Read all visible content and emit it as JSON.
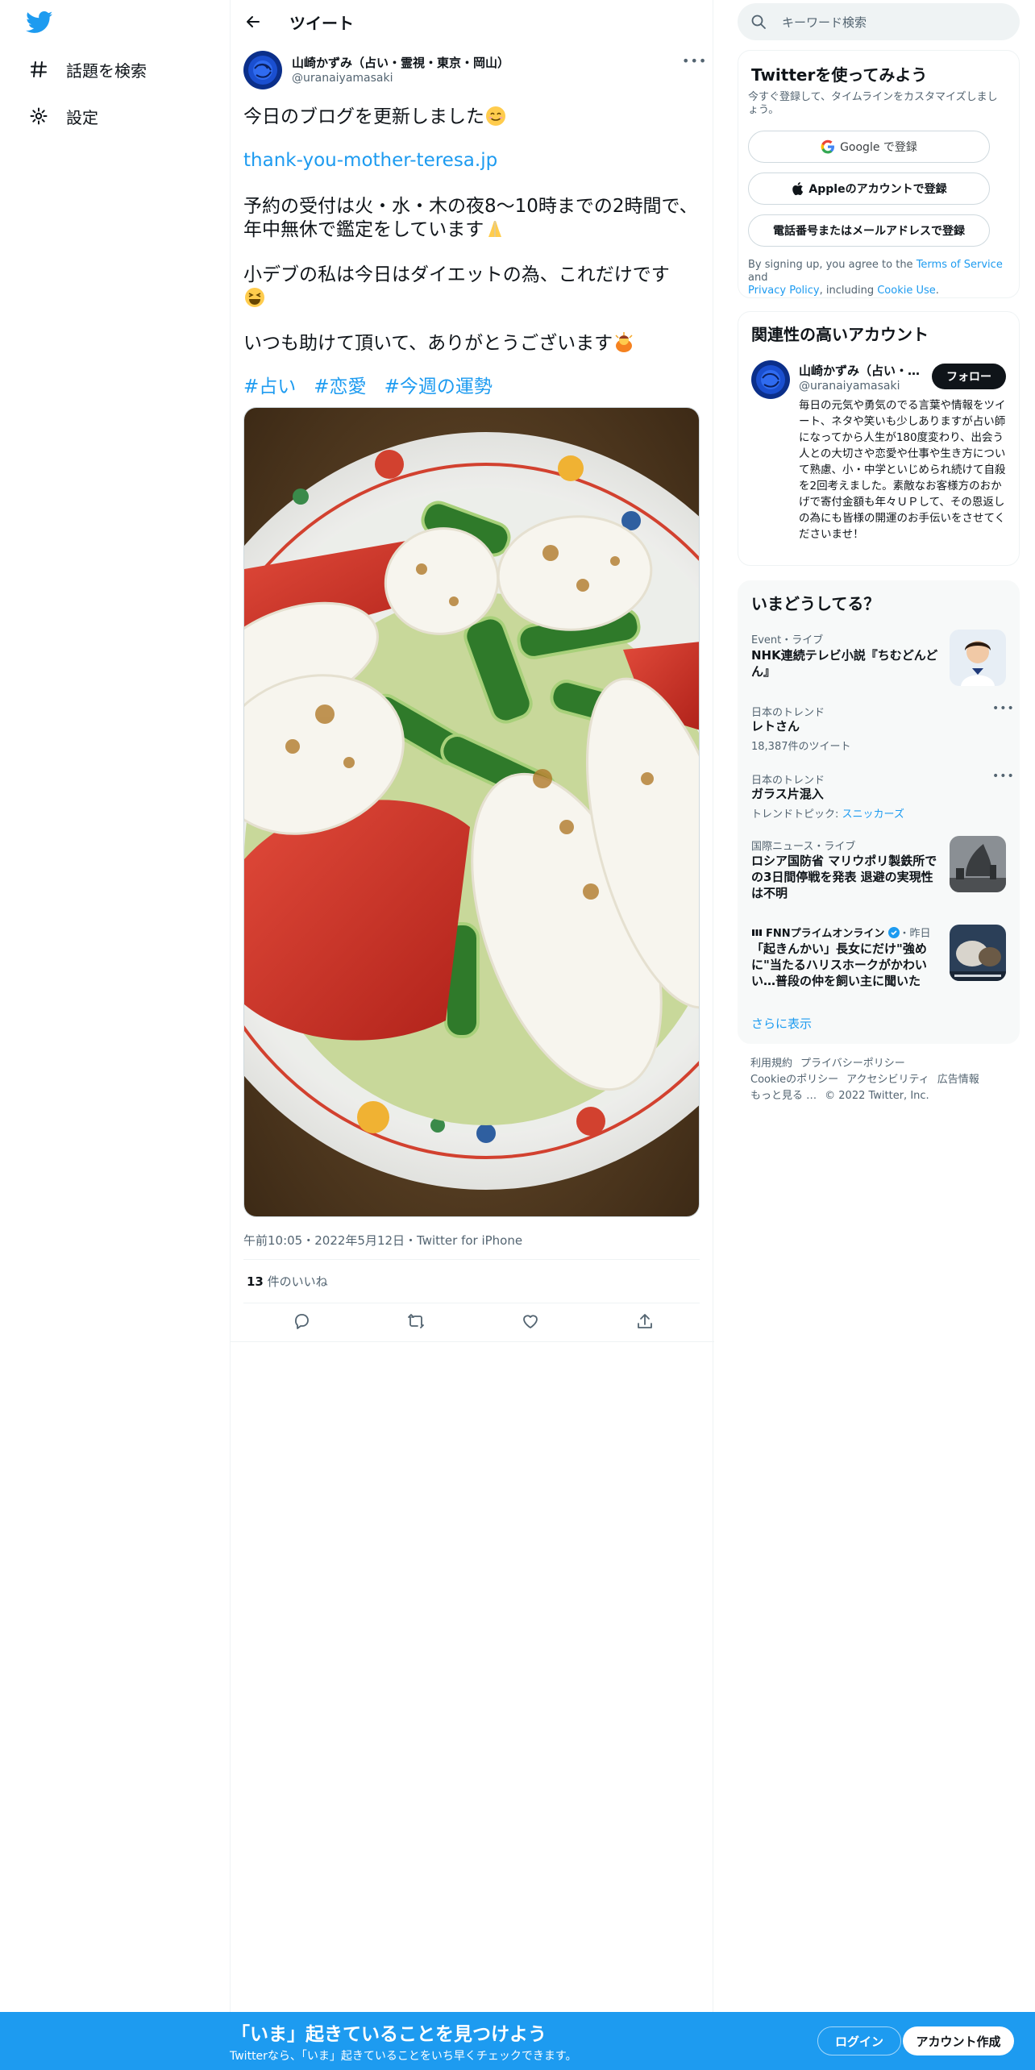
{
  "nav": {
    "explore_label": "話題を検索",
    "settings_label": "設定"
  },
  "header": {
    "title": "ツイート"
  },
  "tweet": {
    "author_name": "山崎かずみ（占い・霊視・東京・岡山）",
    "author_handle": "@uranaiyamasaki",
    "line1": "今日のブログを更新しました",
    "link": "thank-you-mother-teresa.jp",
    "line2a": "予約の受付は火・水・木の夜8〜10時までの2時間で、",
    "line2b": "年中無休で鑑定をしています",
    "line3": "小デブの私は今日はダイエットの為、これだけです",
    "line4": "いつも助けて頂いて、ありがとうございます",
    "hashtags": [
      "#占い",
      "#恋愛",
      "#今週の運勢"
    ],
    "meta": "午前10:05・2022年5月12日・Twitter for iPhone",
    "likes_count": "13",
    "likes_label": " 件のいいね"
  },
  "search": {
    "placeholder": "キーワード検索"
  },
  "signup_card": {
    "title": "Twitterを使ってみよう",
    "subtitle": "今すぐ登録して、タイムラインをカスタマイズしましょう。",
    "google_label": "Google で登録",
    "apple_label": "Appleのアカウントで登録",
    "phone_label": "電話番号またはメールアドレスで登録",
    "terms_prefix": "By signing up, you agree to the ",
    "terms_link": "Terms of Service",
    "terms_and": " and",
    "privacy_link": "Privacy Policy",
    "including": ", including ",
    "cookie_link": "Cookie Use",
    "period": "."
  },
  "related_card": {
    "title": "関連性の高いアカウント",
    "name": "山崎かずみ（占い・…",
    "handle": "@uranaiyamasaki",
    "follow_label": "フォロー",
    "bio": "毎日の元気や勇気のでる言葉や情報をツイート、ネタや笑いも少しありますが占い師になってから人生が180度変わり、出会う人との大切さや恋愛や仕事や生き方について熟慮、小・中学といじめられ続けて自殺を2回考えました。素敵なお客様方のおかげで寄付金額も年々ＵＰして、その恩返しの為にも皆様の開運のお手伝いをさせてくださいませ！"
  },
  "trends_card": {
    "title": "いまどうしてる？",
    "show_more": "さらに表示",
    "items": [
      {
        "category": "Event・ライブ",
        "title": "NHK連続テレビ小説『ちむどんどん』"
      },
      {
        "category": "日本のトレンド",
        "title": "レトさん",
        "sub": "18,387件のツイート"
      },
      {
        "category": "日本のトレンド",
        "title": "ガラス片混入",
        "sub_prefix": "トレンドトピック: ",
        "sub_link": "スニッカーズ"
      },
      {
        "category": "国際ニュース・ライブ",
        "title": "ロシア国防省 マリウポリ製鉄所での3日間停戦を発表 退避の実現性は不明"
      },
      {
        "category": "FNNプライムオンライン",
        "category_suffix": "・昨日",
        "title": "「起きんかい」長女にだけ\"強め に\"当たるハリスホークがかわいい…普段の仲を飼い主に聞いた"
      }
    ]
  },
  "footer": {
    "links": [
      "利用規約",
      "プライバシーポリシー",
      "Cookieのポリシー",
      "アクセシビリティ",
      "広告情報",
      "もっと見る …",
      "© 2022 Twitter, Inc."
    ]
  },
  "bottom_bar": {
    "title": "「いま」起きていることを見つけよう",
    "subtitle": "Twitterなら、「いま」起きていることをいち早くチェックできます。",
    "login_label": "ログイン",
    "signup_label": "アカウント作成"
  },
  "colors": {
    "accent": "#1d9bf0",
    "text": "#0f1419",
    "secondary": "#536471"
  }
}
